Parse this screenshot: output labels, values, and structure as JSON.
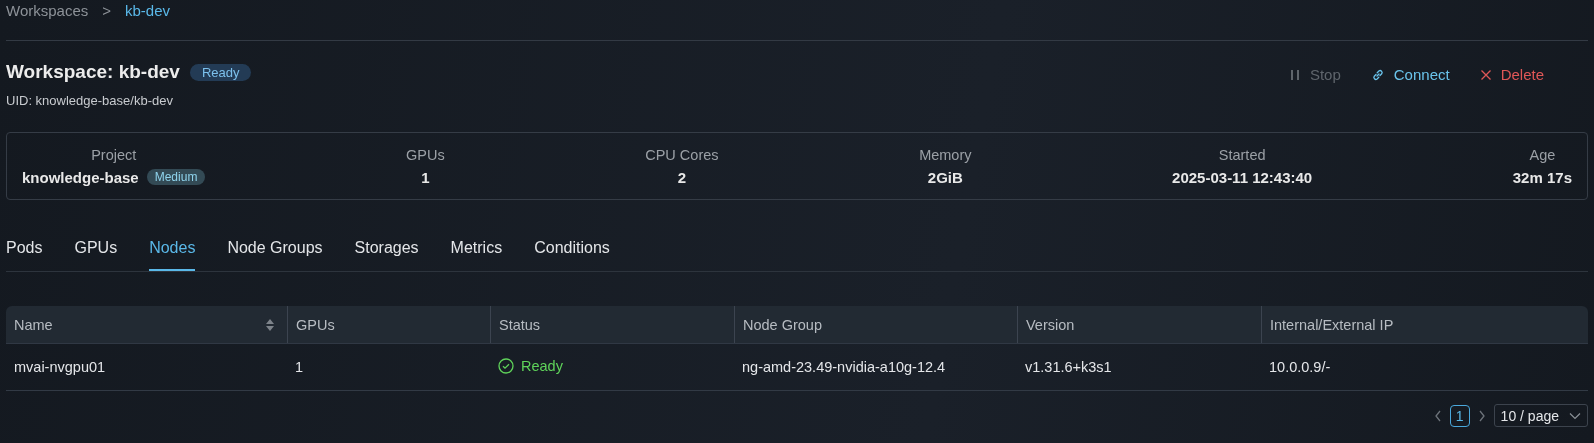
{
  "breadcrumb": [
    {
      "label": "Workspaces",
      "current": false
    },
    {
      "label": "kb-dev",
      "current": true
    }
  ],
  "breadcrumb_separator": ">",
  "header": {
    "title": "Workspace: kb-dev",
    "status_badge": "Ready",
    "uid": "UID: knowledge-base/kb-dev",
    "actions": [
      {
        "label": "Stop",
        "kind": "pause",
        "disabled": true
      },
      {
        "label": "Connect",
        "kind": "link",
        "disabled": false
      },
      {
        "label": "Delete",
        "kind": "delete",
        "disabled": false
      }
    ]
  },
  "summary": [
    {
      "label": "Project",
      "value": "knowledge-base",
      "badge": "Medium"
    },
    {
      "label": "GPUs",
      "value": "1"
    },
    {
      "label": "CPU Cores",
      "value": "2"
    },
    {
      "label": "Memory",
      "value": "2GiB"
    },
    {
      "label": "Started",
      "value": "2025-03-11 12:43:40"
    },
    {
      "label": "Age",
      "value": "32m 17s"
    }
  ],
  "tabs": [
    {
      "label": "Pods",
      "selected": false
    },
    {
      "label": "GPUs",
      "selected": false
    },
    {
      "label": "Nodes",
      "selected": true
    },
    {
      "label": "Node Groups",
      "selected": false
    },
    {
      "label": "Storages",
      "selected": false
    },
    {
      "label": "Metrics",
      "selected": false
    },
    {
      "label": "Conditions",
      "selected": false
    }
  ],
  "table": {
    "columns": [
      {
        "label": "Name",
        "sortable": true
      },
      {
        "label": "GPUs",
        "sortable": false
      },
      {
        "label": "Status",
        "sortable": false
      },
      {
        "label": "Node Group",
        "sortable": false
      },
      {
        "label": "Version",
        "sortable": false
      },
      {
        "label": "Internal/External IP",
        "sortable": false
      }
    ],
    "rows": [
      {
        "cells": [
          "mvai-nvgpu01",
          "1",
          {
            "text": "Ready",
            "kind": "ready"
          },
          "ng-amd-23.49-nvidia-a10g-12.4",
          "v1.31.6+k3s1",
          "10.0.0.9/-"
        ]
      }
    ]
  },
  "pagination": {
    "pages": [
      {
        "label": "1",
        "selected": true
      }
    ],
    "page_size": "10 / page"
  }
}
